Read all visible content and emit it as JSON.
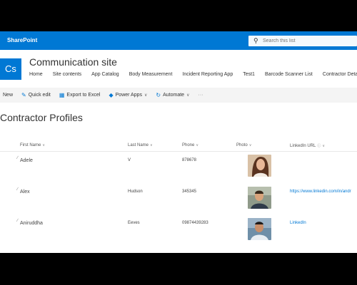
{
  "suite": {
    "brand": "SharePoint",
    "search_placeholder": "Search this list"
  },
  "site": {
    "logo": "Cs",
    "title": "Communication site",
    "nav": [
      "Home",
      "Site contents",
      "App Catalog",
      "Body Measurement",
      "Incident Reporting App",
      "Test1",
      "Barcode Scanner List",
      "Contractor Details"
    ]
  },
  "commands": {
    "new": "New",
    "quick_edit": "Quick edit",
    "export": "Export to Excel",
    "power_apps": "Power Apps",
    "automate": "Automate",
    "more": "···"
  },
  "list": {
    "title": "Contractor Profiles",
    "columns": {
      "first_name": "First Name",
      "last_name": "Last Name",
      "phone": "Phone",
      "photo": "Photo",
      "linkedin": "LinkedIn URL"
    },
    "rows": [
      {
        "first": "Adele",
        "last": "V",
        "phone": "878678",
        "linkedin": ""
      },
      {
        "first": "Alex",
        "last": "Hudson",
        "phone": "345345",
        "linkedin": "https://www.linkedin.com/in/andr"
      },
      {
        "first": "Aniruddha",
        "last": "Eeves",
        "phone": "09874439283",
        "linkedin": "LinkedIn"
      }
    ]
  },
  "colors": {
    "accent": "#0078d4",
    "commandbar": "#f4f4f4"
  },
  "icons": [
    "search-icon",
    "edit-icon",
    "excel-icon",
    "power-apps-icon",
    "automate-icon",
    "chevron-down-icon",
    "info-icon"
  ]
}
